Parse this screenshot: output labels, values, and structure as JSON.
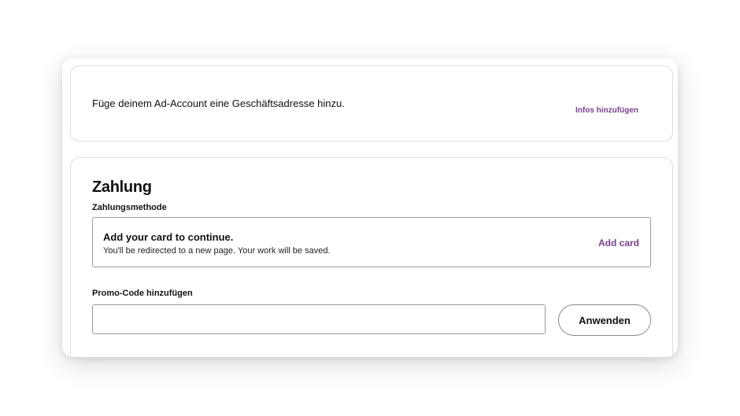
{
  "address_card": {
    "text": "Füge deinem Ad-Account eine Geschäftsadresse hinzu.",
    "link_label": "Infos hinzufügen"
  },
  "payment": {
    "title": "Zahlung",
    "method_label": "Zahlungsmethode",
    "card_prompt_title": "Add your card to continue.",
    "card_prompt_subtitle": "You'll be redirected to a new page. Your work will be saved.",
    "add_card_label": "Add card",
    "promo_label": "Promo-Code hinzufügen",
    "promo_value": "",
    "promo_placeholder": "",
    "apply_label": "Anwenden"
  },
  "colors": {
    "accent_link": "#7b3e8e",
    "border": "#9a9a9a"
  }
}
